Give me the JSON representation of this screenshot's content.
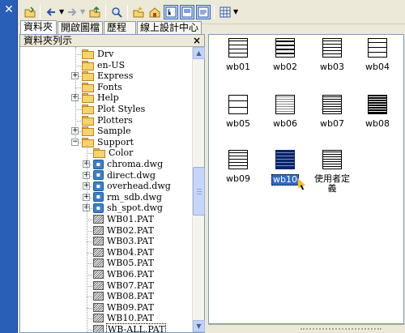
{
  "palette": {
    "close_glyph": "✕"
  },
  "toolbar": {
    "buttons": [
      "load-icon",
      "back-icon",
      "forward-icon",
      "up-icon",
      "search-icon",
      "favorites-icon",
      "home-icon",
      "tree-toggle-icon",
      "preview-icon",
      "description-icon",
      "views-icon"
    ]
  },
  "tabs": [
    {
      "label": "資料夾"
    },
    {
      "label": "開啟圖檔"
    },
    {
      "label": "歷程"
    },
    {
      "label": "線上設計中心"
    }
  ],
  "tree": {
    "header": "資料夾列示",
    "close_glyph": "×",
    "items": [
      {
        "label": "Drv",
        "type": "folder"
      },
      {
        "label": "en-US",
        "type": "folder"
      },
      {
        "label": "Express",
        "type": "folder"
      },
      {
        "label": "Fonts",
        "type": "folder"
      },
      {
        "label": "Help",
        "type": "folder"
      },
      {
        "label": "Plot Styles",
        "type": "folder"
      },
      {
        "label": "Plotters",
        "type": "folder"
      },
      {
        "label": "Sample",
        "type": "folder"
      },
      {
        "label": "Support",
        "type": "folder"
      },
      {
        "label": "Color",
        "type": "folder"
      },
      {
        "label": "chroma.dwg",
        "type": "dwg"
      },
      {
        "label": "direct.dwg",
        "type": "dwg"
      },
      {
        "label": "overhead.dwg",
        "type": "dwg"
      },
      {
        "label": "rm_sdb.dwg",
        "type": "dwg"
      },
      {
        "label": "sh_spot.dwg",
        "type": "dwg"
      },
      {
        "label": "WB01.PAT",
        "type": "pat"
      },
      {
        "label": "WB02.PAT",
        "type": "pat"
      },
      {
        "label": "WB03.PAT",
        "type": "pat"
      },
      {
        "label": "WB04.PAT",
        "type": "pat"
      },
      {
        "label": "WB05.PAT",
        "type": "pat"
      },
      {
        "label": "WB06.PAT",
        "type": "pat"
      },
      {
        "label": "WB07.PAT",
        "type": "pat"
      },
      {
        "label": "WB08.PAT",
        "type": "pat"
      },
      {
        "label": "WB09.PAT",
        "type": "pat"
      },
      {
        "label": "WB10.PAT",
        "type": "pat"
      },
      {
        "label": "WB-ALL.PAT",
        "type": "pat",
        "selected": true
      }
    ]
  },
  "patterns": [
    {
      "label": "wb01"
    },
    {
      "label": "wb02"
    },
    {
      "label": "wb03"
    },
    {
      "label": "wb04"
    },
    {
      "label": "wb05"
    },
    {
      "label": "wb06"
    },
    {
      "label": "wb07"
    },
    {
      "label": "wb08"
    },
    {
      "label": "wb09"
    },
    {
      "label": "wb10",
      "selected": true
    },
    {
      "label": "使用者定義"
    }
  ],
  "colors": {
    "palette_title_bar": "#2a5fb8",
    "selection": "#316ac5",
    "folder": "#f7d36a"
  }
}
